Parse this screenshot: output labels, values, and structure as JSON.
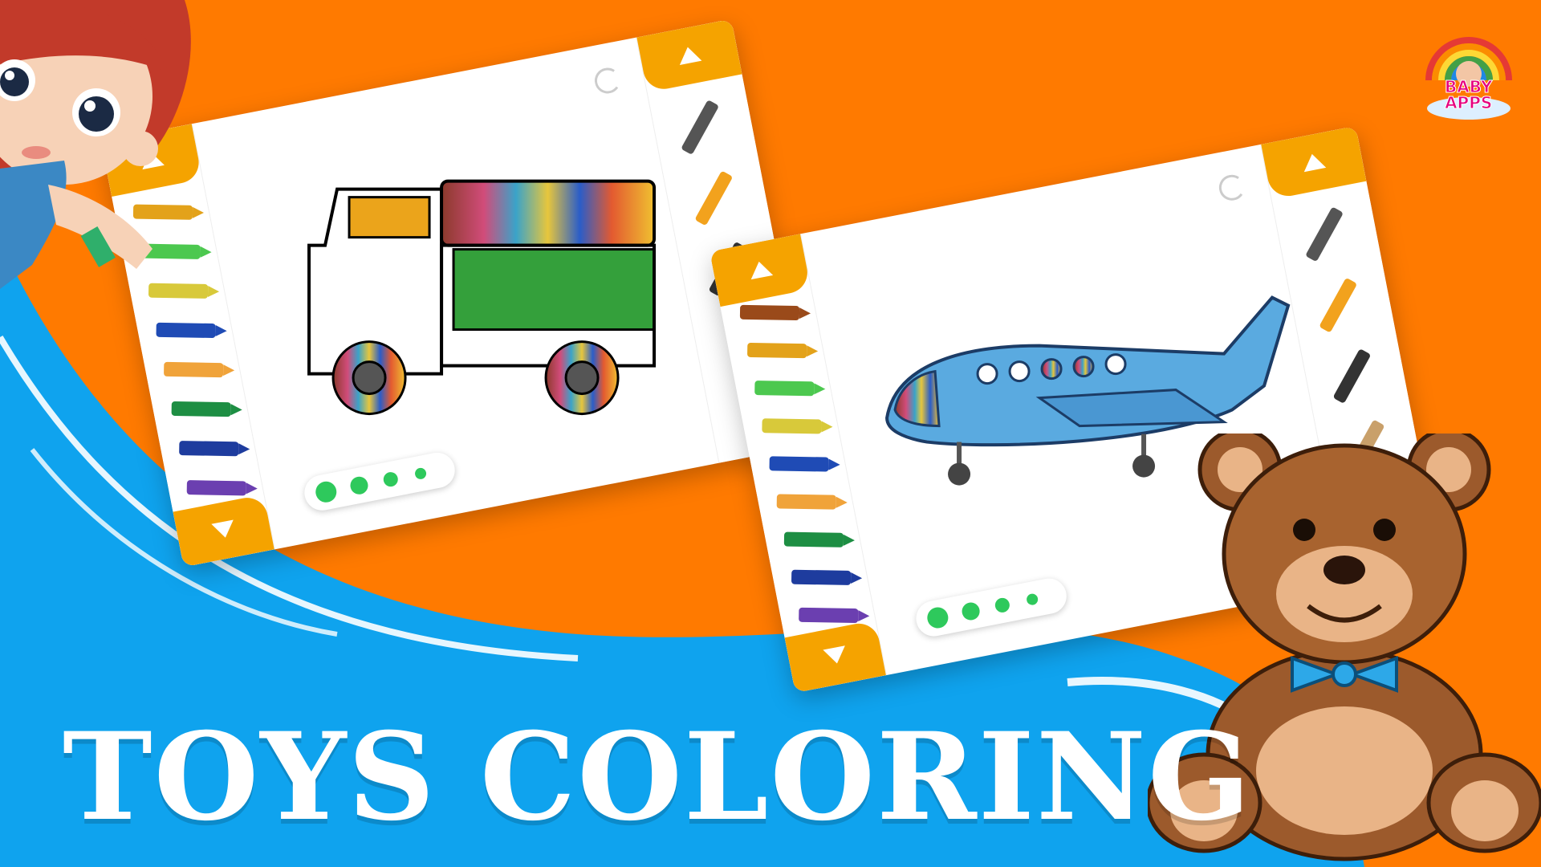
{
  "title": "TOYS COLORING",
  "logo": {
    "line1": "BABY",
    "line2": "APPS"
  },
  "colors": {
    "background": "#FF7A00",
    "wave_blue": "#0FA3EE",
    "panel_accent": "#F5A300",
    "progress_dot": "#2EC95C",
    "title_text": "#FFFFFF"
  },
  "screens": [
    {
      "name": "truck",
      "crayons": [
        "#E3A21A",
        "#4CC84F",
        "#D8C93A",
        "#1F4BB5",
        "#F0A33A",
        "#1D8E43",
        "#1E3C9E",
        "#6B3FB0"
      ],
      "tools": [
        "pencil-gray-icon",
        "pencil-orange-icon",
        "brush-icon"
      ],
      "progress_dots": 4
    },
    {
      "name": "airplane",
      "crayons": [
        "#9A4A1A",
        "#E3A21A",
        "#4CC84F",
        "#D8C93A",
        "#1F4BB5",
        "#F0A33A",
        "#1D8E43",
        "#1E3C9E",
        "#6B3FB0"
      ],
      "tools": [
        "pencil-gray-icon",
        "pencil-orange-icon",
        "brush-icon",
        "paint-brush-icon",
        "roller-icon"
      ],
      "progress_dots": 4
    }
  ]
}
